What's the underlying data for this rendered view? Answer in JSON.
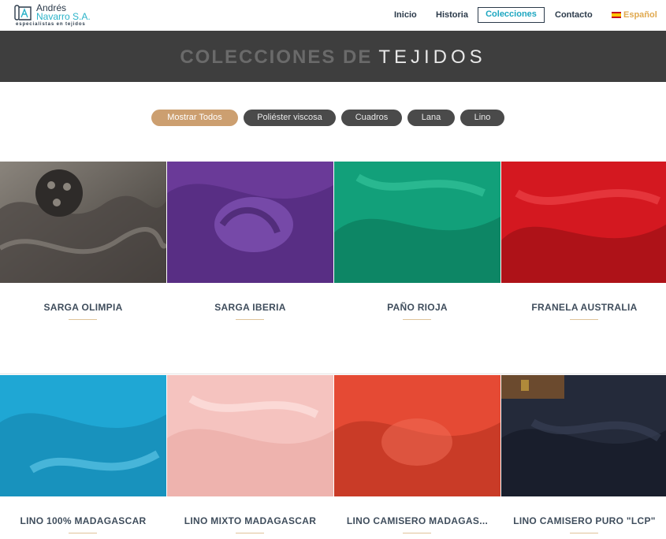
{
  "header": {
    "logo": {
      "name_line1": "Andrés",
      "name_line2": "Navarro S.A.",
      "tagline": "especialistas en tejidos"
    },
    "nav": [
      {
        "label": "Inicio"
      },
      {
        "label": "Historia"
      },
      {
        "label": "Colecciones",
        "active": true
      },
      {
        "label": "Contacto"
      }
    ],
    "language": {
      "label": "Español",
      "icon": "spain-flag-icon"
    }
  },
  "banner": {
    "title_part1": "COLECCIONES DE",
    "title_part2": "TEJIDOS"
  },
  "filters": [
    {
      "label": "Mostrar Todos",
      "selected": true
    },
    {
      "label": "Poliéster viscosa"
    },
    {
      "label": "Cuadros"
    },
    {
      "label": "Lana"
    },
    {
      "label": "Lino"
    }
  ],
  "products": [
    {
      "title": "SARGA OLIMPIA",
      "color": "#5f5a55"
    },
    {
      "title": "SARGA IBERIA",
      "color": "#6a3a98"
    },
    {
      "title": "PAÑO RIOJA",
      "color": "#12a07a"
    },
    {
      "title": "FRANELA AUSTRALIA",
      "color": "#d41820"
    },
    {
      "title": "LINO 100% MADAGASCAR",
      "color": "#1fa7d4"
    },
    {
      "title": "LINO MIXTO MADAGASCAR",
      "color": "#f5c3bf"
    },
    {
      "title": "LINO CAMISERO MADAGAS...",
      "color": "#e54a34"
    },
    {
      "title": "LINO CAMISERO PURO \"LCP\"",
      "color": "#242a3a"
    }
  ]
}
